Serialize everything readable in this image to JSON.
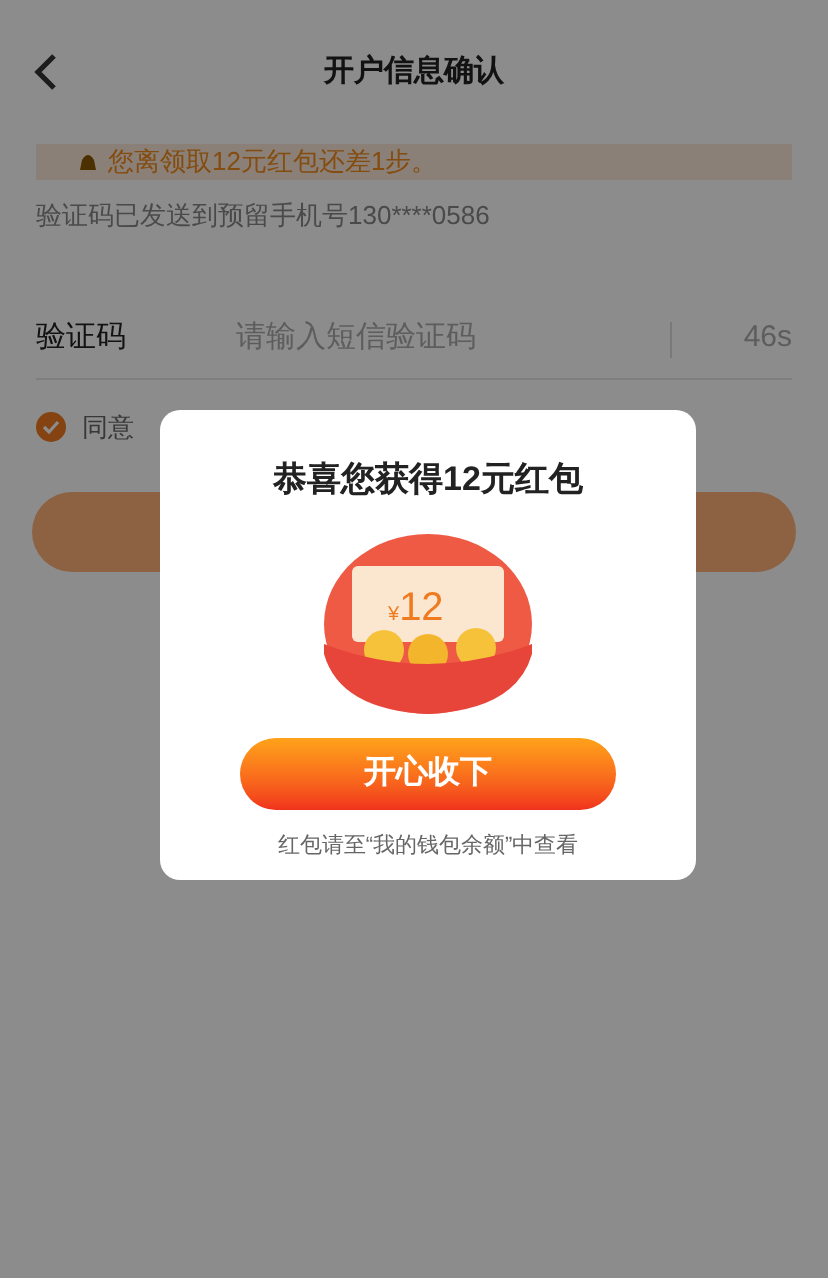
{
  "header": {
    "title": "开户信息确认"
  },
  "banner": {
    "text": "您离领取12元红包还差1步。"
  },
  "sent_note": "验证码已发送到预留手机号130****0586",
  "code_field": {
    "label": "验证码",
    "placeholder": "请输入短信验证码",
    "countdown": "46s"
  },
  "agreement": {
    "checked": true,
    "text": "同意"
  },
  "modal": {
    "title": "恭喜您获得12元红包",
    "currency": "¥",
    "amount": "12",
    "button": "开心收下",
    "note": "红包请至“我的钱包余额”中查看"
  }
}
